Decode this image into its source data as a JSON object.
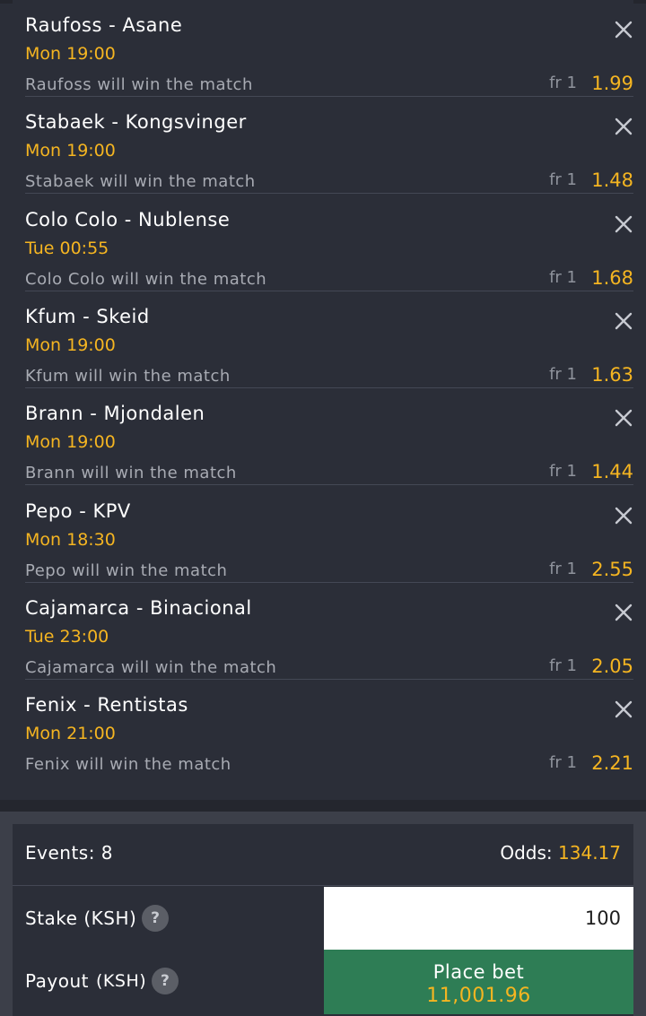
{
  "bets": [
    {
      "match": "Raufoss - Asane",
      "time": "Mon 19:00",
      "selection": "Raufoss will win the match",
      "fr": "fr 1",
      "odds": "1.99"
    },
    {
      "match": "Stabaek - Kongsvinger",
      "time": "Mon 19:00",
      "selection": "Stabaek will win the match",
      "fr": "fr 1",
      "odds": "1.48"
    },
    {
      "match": "Colo Colo - Nublense",
      "time": "Tue 00:55",
      "selection": "Colo Colo will win the match",
      "fr": "fr 1",
      "odds": "1.68"
    },
    {
      "match": "Kfum - Skeid",
      "time": "Mon 19:00",
      "selection": "Kfum will win the match",
      "fr": "fr 1",
      "odds": "1.63"
    },
    {
      "match": "Brann - Mjondalen",
      "time": "Mon 19:00",
      "selection": "Brann will win the match",
      "fr": "fr 1",
      "odds": "1.44"
    },
    {
      "match": "Pepo - KPV",
      "time": "Mon 18:30",
      "selection": "Pepo will win the match",
      "fr": "fr 1",
      "odds": "2.55"
    },
    {
      "match": "Cajamarca - Binacional",
      "time": "Tue 23:00",
      "selection": "Cajamarca will win the match",
      "fr": "fr 1",
      "odds": "2.05"
    },
    {
      "match": "Fenix - Rentistas",
      "time": "Mon 21:00",
      "selection": "Fenix will win the match",
      "fr": "fr 1",
      "odds": "2.21"
    }
  ],
  "summary": {
    "events_label": "Events: 8",
    "odds_label": "Odds:",
    "odds_value": "134.17",
    "stake_label": "Stake (KSH)",
    "stake_value": "100",
    "payout_label": "Payout",
    "payout_currency": "(KSH)",
    "help_glyph": "?",
    "place_bet_label": "Place bet",
    "payout_value": "11,001.96"
  },
  "colors": {
    "accent": "#f5b521",
    "background": "#2b2e38",
    "place_bet": "#2e7d55"
  },
  "icons": {
    "remove": "close-icon",
    "help": "help-icon"
  }
}
